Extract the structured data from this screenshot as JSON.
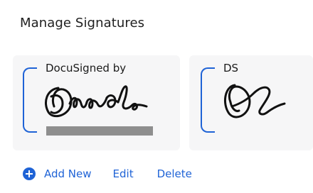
{
  "page": {
    "title": "Manage Signatures"
  },
  "signatures": [
    {
      "label": "DocuSigned by",
      "type": "signature",
      "name_redacted": true
    },
    {
      "label": "DS",
      "type": "initials"
    }
  ],
  "actions": {
    "add_label": "Add New",
    "edit_label": "Edit",
    "delete_label": "Delete"
  },
  "icons": {
    "add": "plus-circle-icon"
  },
  "colors": {
    "accent": "#1f63d6",
    "card_bg": "#f6f6f7",
    "redaction": "#8e8e8e"
  }
}
